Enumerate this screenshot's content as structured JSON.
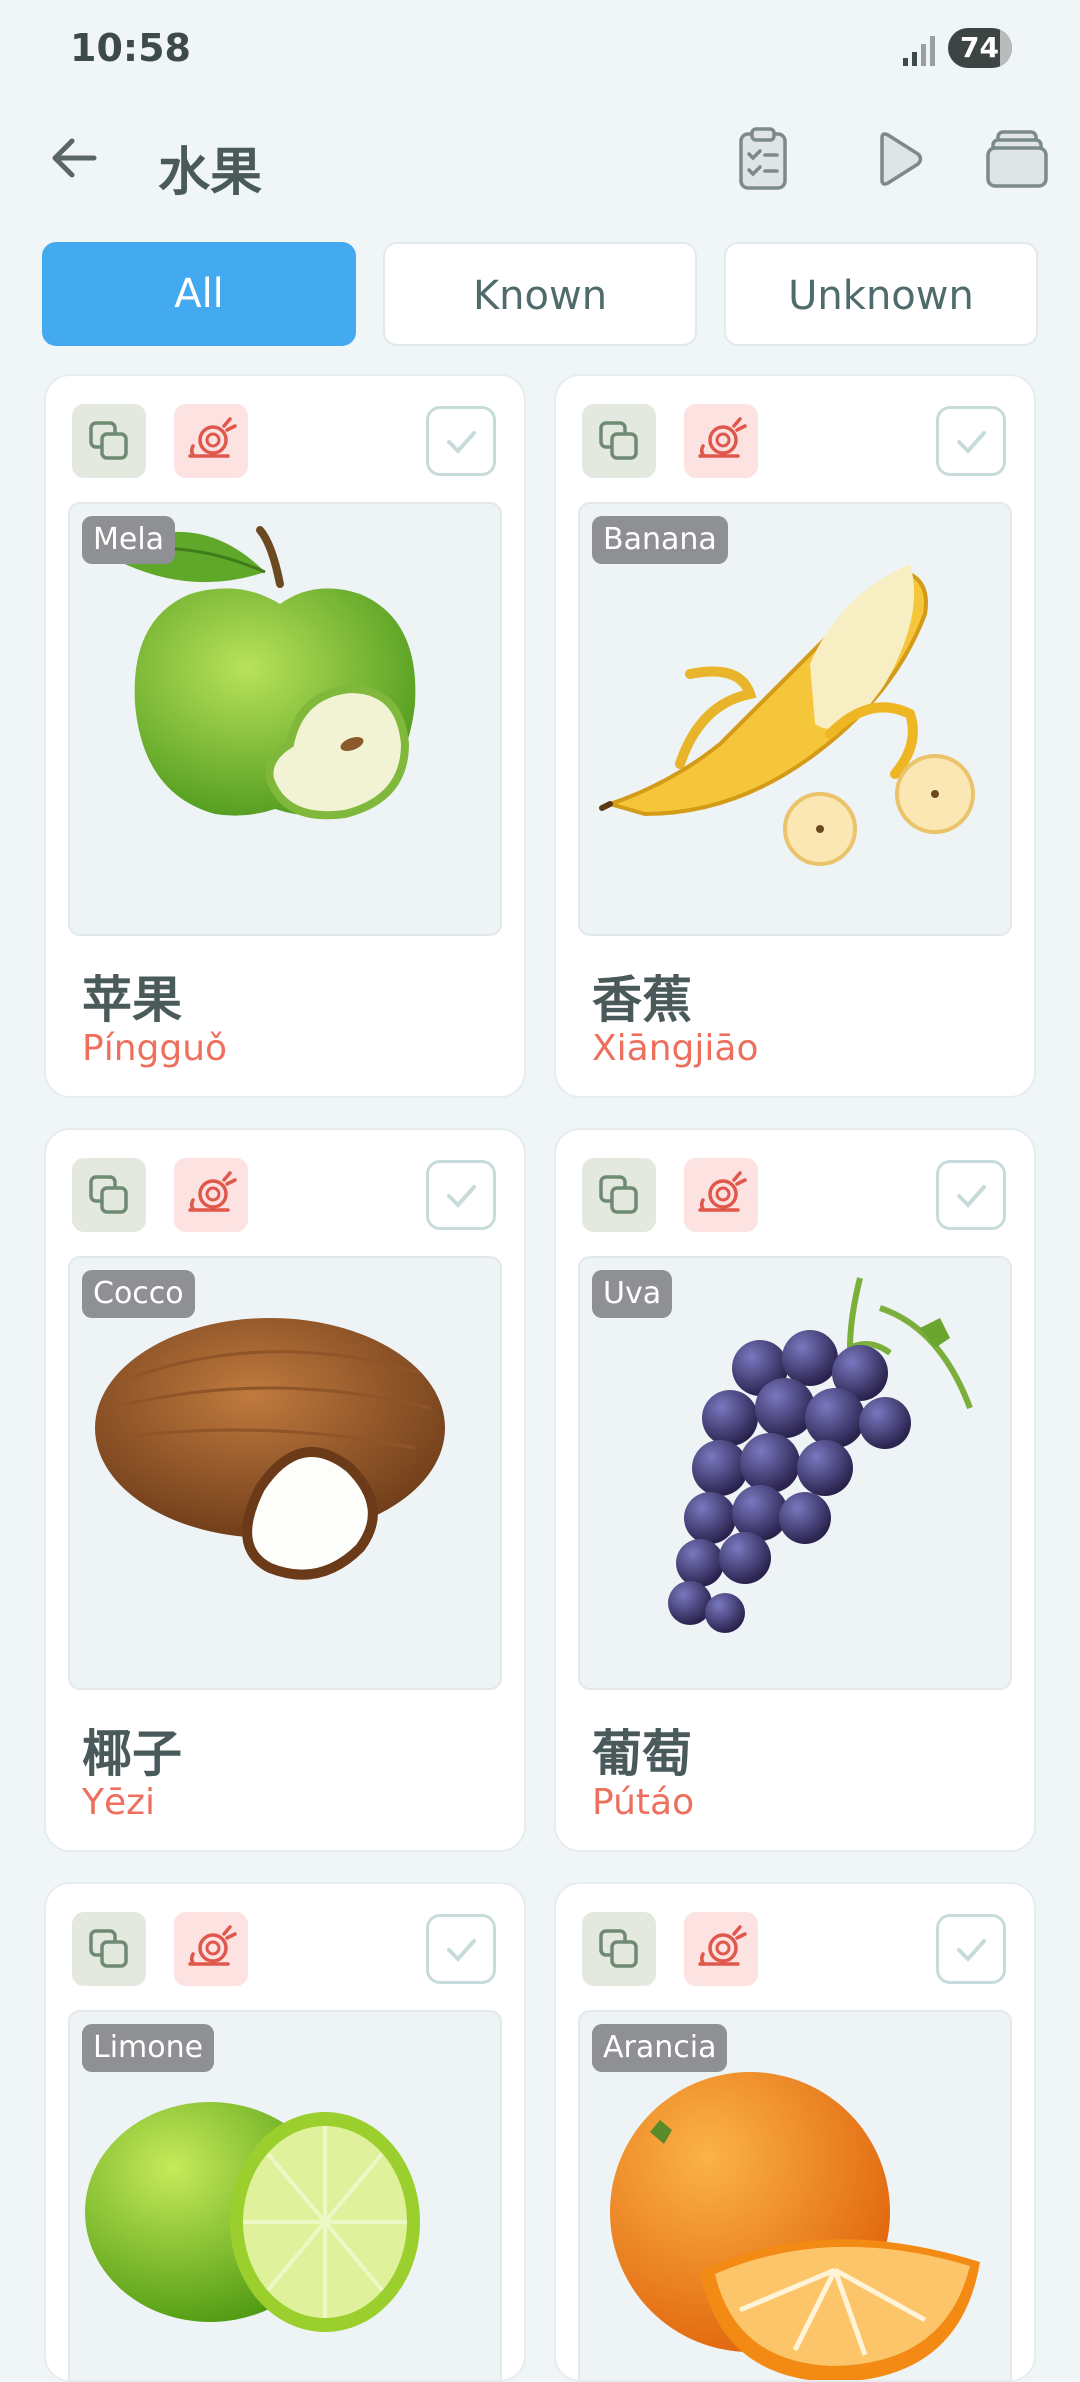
{
  "status_bar": {
    "time": "10:58",
    "battery": "74"
  },
  "header": {
    "title": "水果"
  },
  "filters": [
    {
      "label": "All",
      "active": true
    },
    {
      "label": "Known",
      "active": false
    },
    {
      "label": "Unknown",
      "active": false
    }
  ],
  "cards": [
    {
      "image_label": "Mela",
      "hanzi": "苹果",
      "pinyin": "Píngguǒ",
      "icon": "apple-image"
    },
    {
      "image_label": "Banana",
      "hanzi": "香蕉",
      "pinyin": "Xiāngjiāo",
      "icon": "banana-image"
    },
    {
      "image_label": "Cocco",
      "hanzi": "椰子",
      "pinyin": "Yēzi",
      "icon": "coconut-image"
    },
    {
      "image_label": "Uva",
      "hanzi": "葡萄",
      "pinyin": "Pútáo",
      "icon": "grapes-image"
    },
    {
      "image_label": "Limone",
      "hanzi": "",
      "pinyin": "",
      "icon": "lime-image"
    },
    {
      "image_label": "Arancia",
      "hanzi": "",
      "pinyin": "",
      "icon": "orange-image"
    }
  ],
  "colors": {
    "accent": "#43aaef",
    "pinyin": "#ee6f5d",
    "background": "#f0f5f8"
  }
}
